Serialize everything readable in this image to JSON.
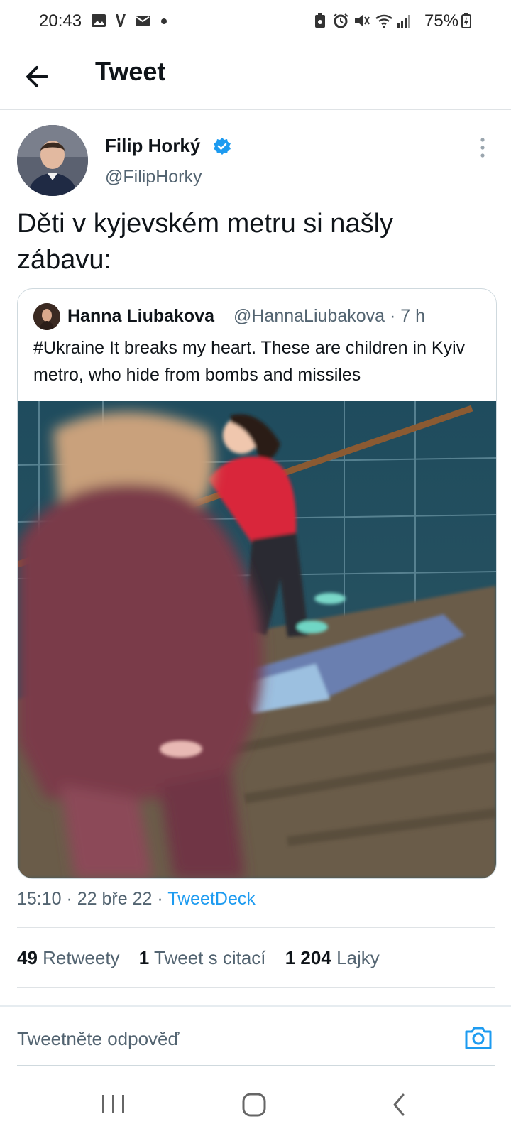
{
  "status_bar": {
    "time": "20:43",
    "battery": "75%"
  },
  "header": {
    "title": "Tweet"
  },
  "tweet": {
    "author_name": "Filip Horký",
    "author_handle": "@FilipHorky",
    "text": "Děti v kyjevském metru si našly zábavu:",
    "quote": {
      "author_name": "Hanna Liubakova",
      "author_handle": "@HannaLiubakova",
      "time_ago": "· 7 h",
      "text": "#Ukraine It breaks my heart. These are children in Kyiv metro, who hide from bombs and missiles"
    },
    "meta": {
      "time_date": "15:10 · 22 bře 22 · ",
      "source": "TweetDeck"
    },
    "stats": {
      "retweets_count": "49",
      "retweets_label": "Retweety",
      "quotes_count": "1",
      "quotes_label": "Tweet s citací",
      "likes_count": "1 204",
      "likes_label": "Lajky"
    }
  },
  "reply": {
    "placeholder": "Tweetněte odpověď"
  },
  "colors": {
    "accent": "#1d9bf0",
    "text_primary": "#0f1419",
    "text_secondary": "#536471"
  },
  "icons": [
    "back-arrow-icon",
    "verified-badge-icon",
    "more-vertical-icon",
    "camera-icon",
    "recent-apps-icon",
    "home-icon",
    "nav-back-icon"
  ]
}
